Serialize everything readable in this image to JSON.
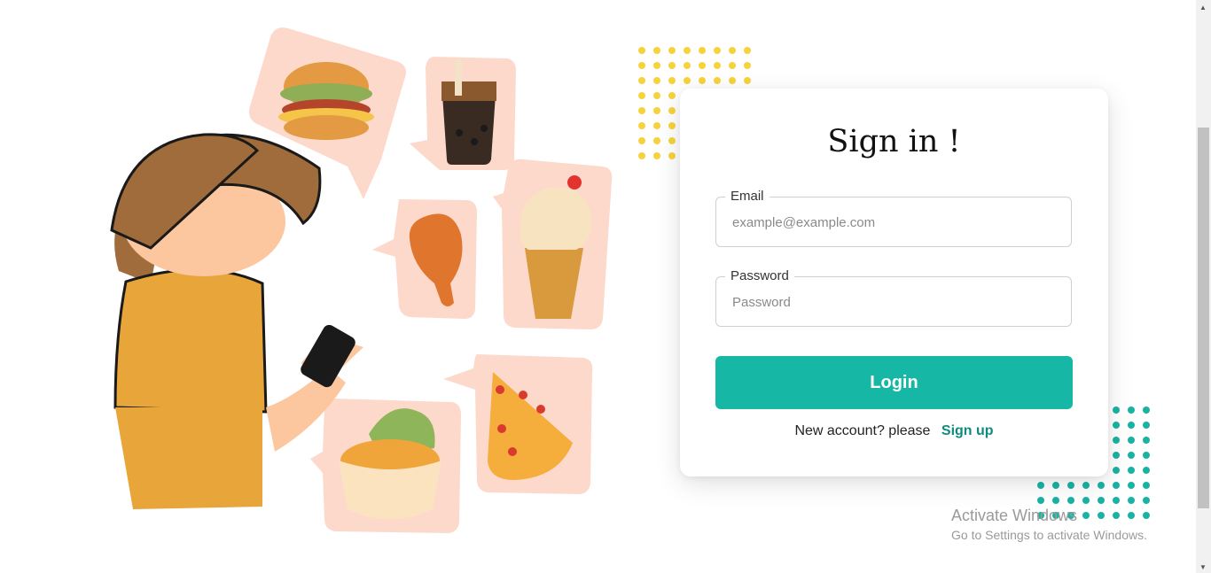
{
  "signin": {
    "title": "Sign in !",
    "email": {
      "label": "Email",
      "placeholder": "example@example.com",
      "value": ""
    },
    "password": {
      "label": "Password",
      "placeholder": "Password",
      "value": ""
    },
    "login_label": "Login",
    "signup_prompt": "New account? please",
    "signup_link": "Sign up"
  },
  "watermark": {
    "title": "Activate Windows",
    "subtitle": "Go to Settings to activate Windows."
  },
  "colors": {
    "accent": "#17b7a5",
    "link": "#118a7e",
    "dots_yellow": "#f6d33c",
    "dots_teal": "#19b3a3",
    "bubble": "#fdd9cc"
  },
  "icons": [
    "woman-with-phone-illustration",
    "burger-icon",
    "bubble-tea-icon",
    "chicken-leg-icon",
    "ice-cream-icon",
    "noodle-bowl-icon",
    "pizza-slice-icon"
  ]
}
